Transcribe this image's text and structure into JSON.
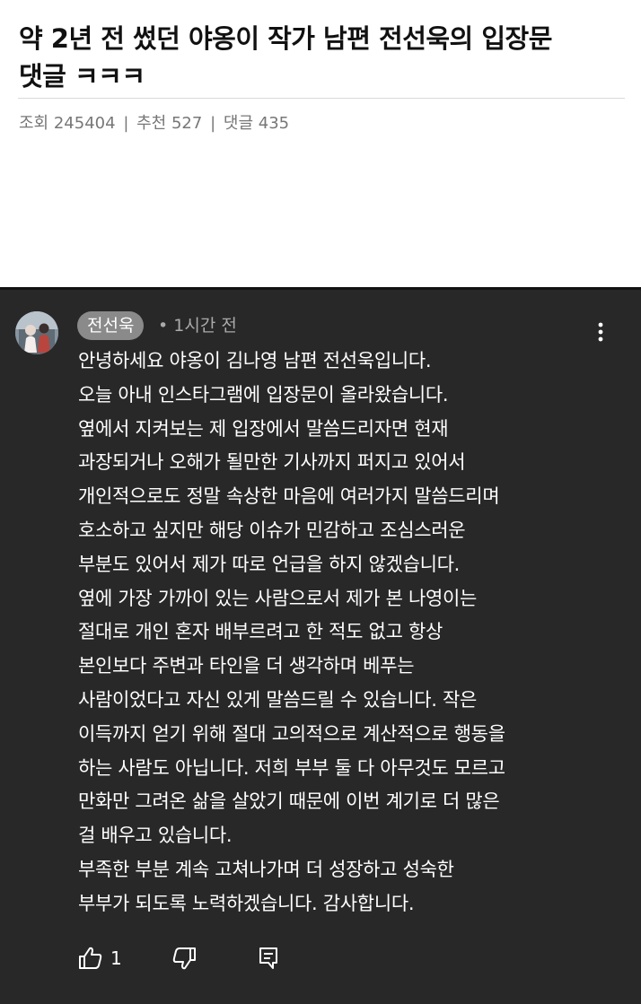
{
  "post": {
    "title_line1": "약 2년 전 썼던 야옹이 작가 남편 전선욱의 입장문",
    "title_line2": "댓글 ㅋㅋㅋ",
    "meta": {
      "views_label": "조회",
      "views_value": "245404",
      "separator": "|",
      "recommend_label": "추천",
      "recommend_value": "527",
      "comments_label": "댓글",
      "comments_value": "435"
    }
  },
  "comment": {
    "author": "전선욱",
    "time": "• 1시간 전",
    "lines": [
      "안녕하세요 야옹이 김나영 남편 전선욱입니다.",
      "오늘 아내 인스타그램에 입장문이 올라왔습니다.",
      "옆에서 지켜보는 제 입장에서 말씀드리자면 현재",
      "과장되거나 오해가 될만한 기사까지 퍼지고 있어서",
      "개인적으로도 정말 속상한 마음에 여러가지 말씀드리며",
      "호소하고 싶지만 해당 이슈가 민감하고 조심스러운",
      "부분도 있어서 제가 따로 언급을 하지 않겠습니다.",
      "옆에 가장 가까이 있는 사람으로서 제가 본 나영이는",
      "절대로 개인 혼자 배부르려고 한 적도 없고 항상",
      "본인보다 주변과 타인을 더 생각하며 베푸는",
      "사람이었다고 자신 있게 말씀드릴 수 있습니다. 작은",
      "이득까지 얻기 위해 절대 고의적으로 계산적으로 행동을",
      "하는 사람도 아닙니다. 저희 부부 둘 다 아무것도 모르고",
      "만화만 그려온 삶을 살았기 때문에 이번 계기로 더 많은",
      "걸 배우고 있습니다.",
      "부족한 부분 계속 고쳐나가며 더 성장하고 성숙한",
      "부부가 되도록 노력하겠습니다. 감사합니다."
    ],
    "like_count": "1"
  },
  "icons": {
    "kebab": "more-vertical-icon",
    "like": "thumbs-up-icon",
    "dislike": "thumbs-down-icon",
    "reply": "reply-comment-icon"
  },
  "colors": {
    "panel_background": "#282828",
    "chip_background": "#8a8a8a",
    "comment_text": "#ffffff",
    "meta_text": "#777777"
  }
}
